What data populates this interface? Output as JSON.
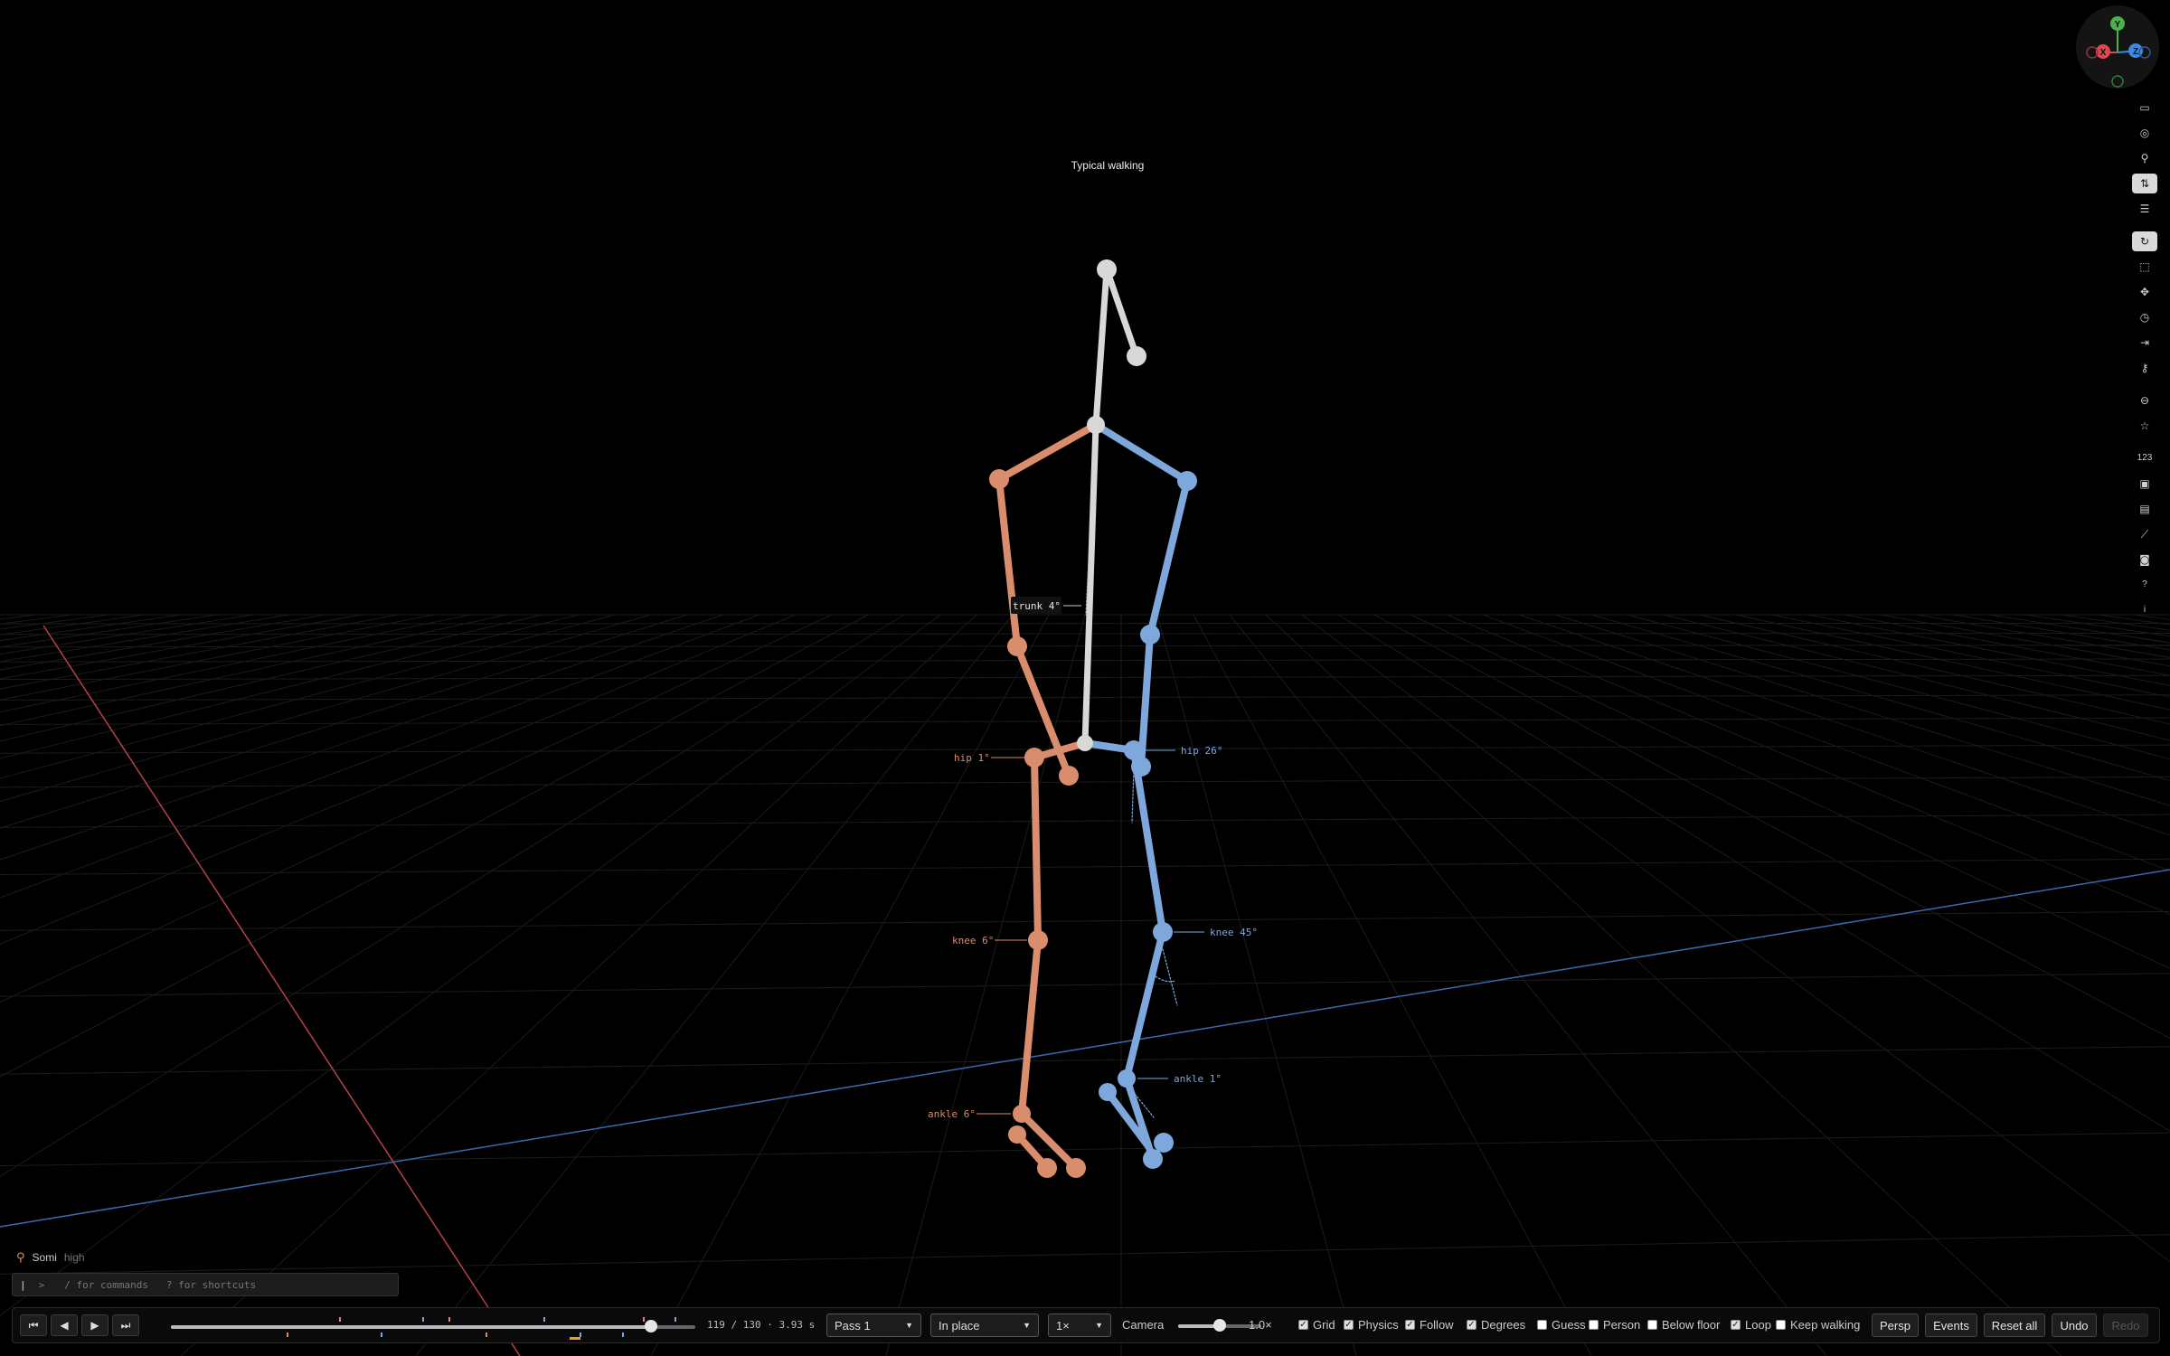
{
  "scene": {
    "title": "Typical walking",
    "annotations": {
      "trunk": "trunk 4°",
      "left_hip": "hip 1°",
      "right_hip": "hip 26°",
      "left_knee": "knee 6°",
      "right_knee": "knee 45°",
      "left_ankle": "ankle 6°",
      "right_ankle": "ankle 1°"
    },
    "colors": {
      "left": "#d98d6c",
      "right": "#7ea7dc",
      "center": "#d8d8d6",
      "x_axis": "#c0444a",
      "z_axis": "#3d6fb8",
      "grid": "#1a1a1a"
    }
  },
  "gizmo": {
    "y": "Y",
    "x": "X",
    "z": "Z"
  },
  "toolbar": {
    "icons": [
      "folder-icon",
      "target-icon",
      "run-icon",
      "walk-pair-icon",
      "list-icon",
      "reset-rotate-icon",
      "select-icon",
      "move-icon",
      "timer-icon",
      "to-end-icon",
      "search-icon",
      "gamepad-icon",
      "star-icon",
      "numbers-icon",
      "video-icon",
      "notes-icon",
      "chart-icon",
      "camera-icon",
      "help-icon",
      "info-icon"
    ],
    "numbers_label": "123",
    "help_label": "?",
    "info_label": "i"
  },
  "chat": {
    "name": "Somi",
    "level": "high",
    "prompt": ">",
    "hint": "/ for commands   ? for shortcuts"
  },
  "playback": {
    "frame_text": "119 / 130 · 3.93 s",
    "progress": 0.9154,
    "pass_select": "Pass 1",
    "mode_select": "In place",
    "speed_select": "1×",
    "camera_label": "Camera",
    "camera_value": "1.0×",
    "camera_level": 0.5
  },
  "options": [
    {
      "label": "Grid",
      "checked": true
    },
    {
      "label": "Physics",
      "checked": true
    },
    {
      "label": "Follow",
      "checked": true
    },
    {
      "label": "Degrees",
      "checked": true
    },
    {
      "label": "Guess",
      "checked": false
    },
    {
      "label": "Person",
      "checked": false
    },
    {
      "label": "Below floor",
      "checked": false
    },
    {
      "label": "Loop",
      "checked": true
    },
    {
      "label": "Keep walking",
      "checked": false
    }
  ],
  "buttons": {
    "persp": "Persp",
    "events": "Events",
    "reset_all": "Reset all",
    "undo": "Undo",
    "redo": "Redo"
  }
}
